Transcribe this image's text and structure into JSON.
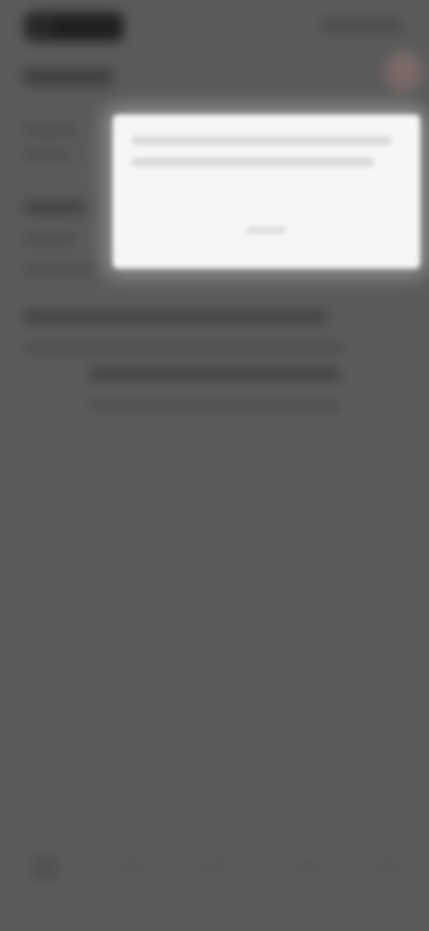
{
  "colors": {
    "background": "#5b5b5b",
    "dialog": "#f6f6f6"
  },
  "icons": {
    "app_logo": "app-logo-icon",
    "avatar": "avatar-icon",
    "home": "home-icon"
  }
}
